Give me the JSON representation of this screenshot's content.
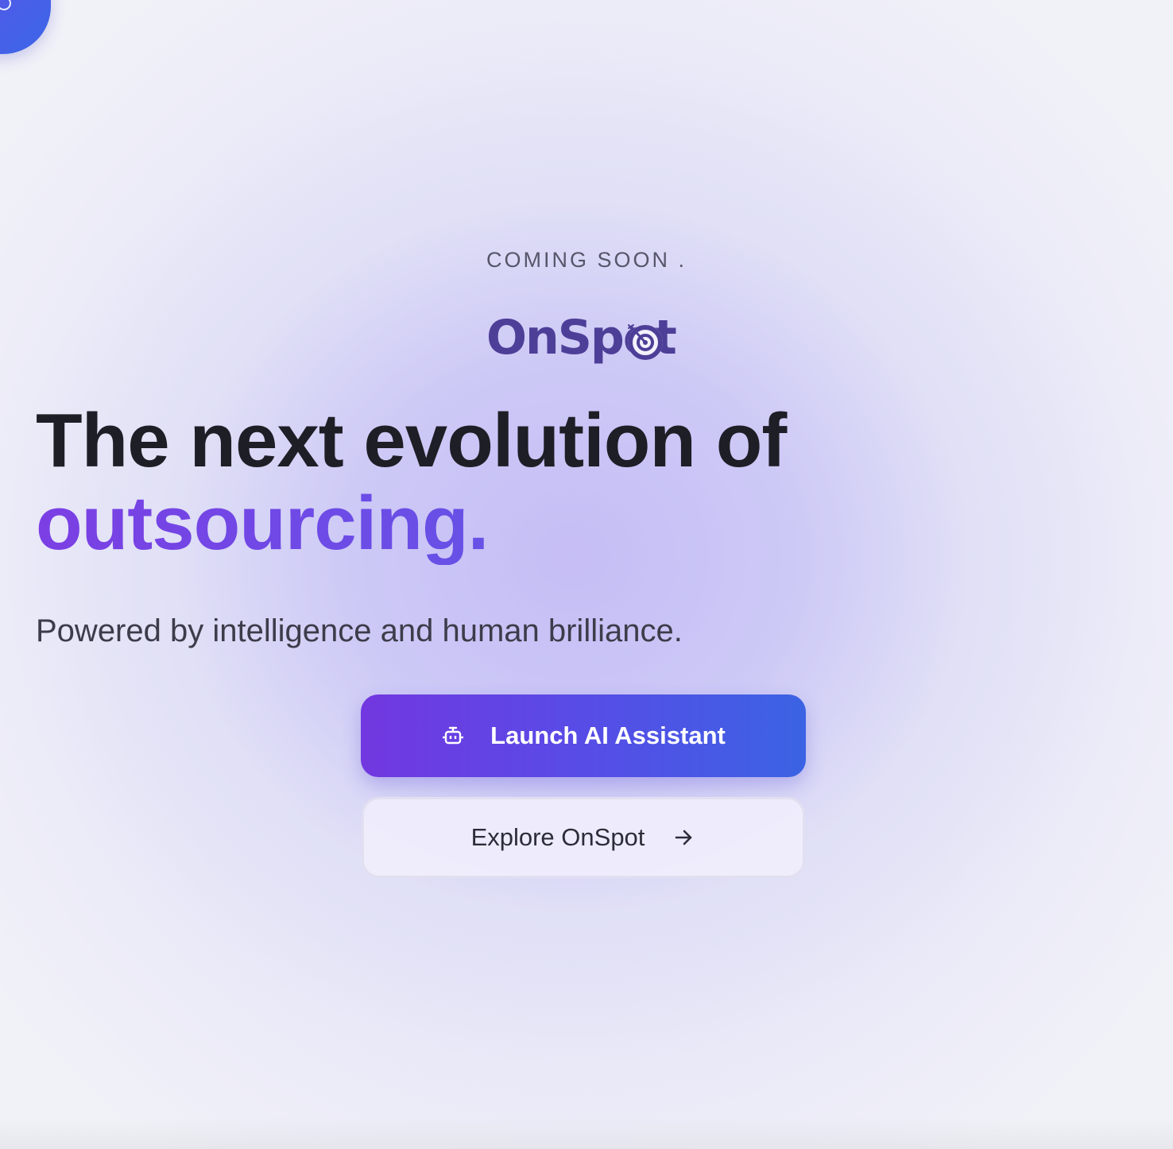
{
  "hero": {
    "eyebrow": "COMING SOON .",
    "logo_text": "OnSpot",
    "headline_line1": "The next evolution of",
    "headline_line2": "outsourcing.",
    "subtitle": "Powered by intelligence and human brilliance."
  },
  "actions": {
    "primary_label": "Launch AI Assistant",
    "primary_icon": "robot-icon",
    "secondary_label": "Explore OnSpot",
    "secondary_icon": "arrow-right-icon"
  },
  "colors": {
    "brand": "#4d3f98",
    "accent_start": "#7237e0",
    "accent_end": "#3b63e4",
    "headline": "#1e1e26"
  }
}
